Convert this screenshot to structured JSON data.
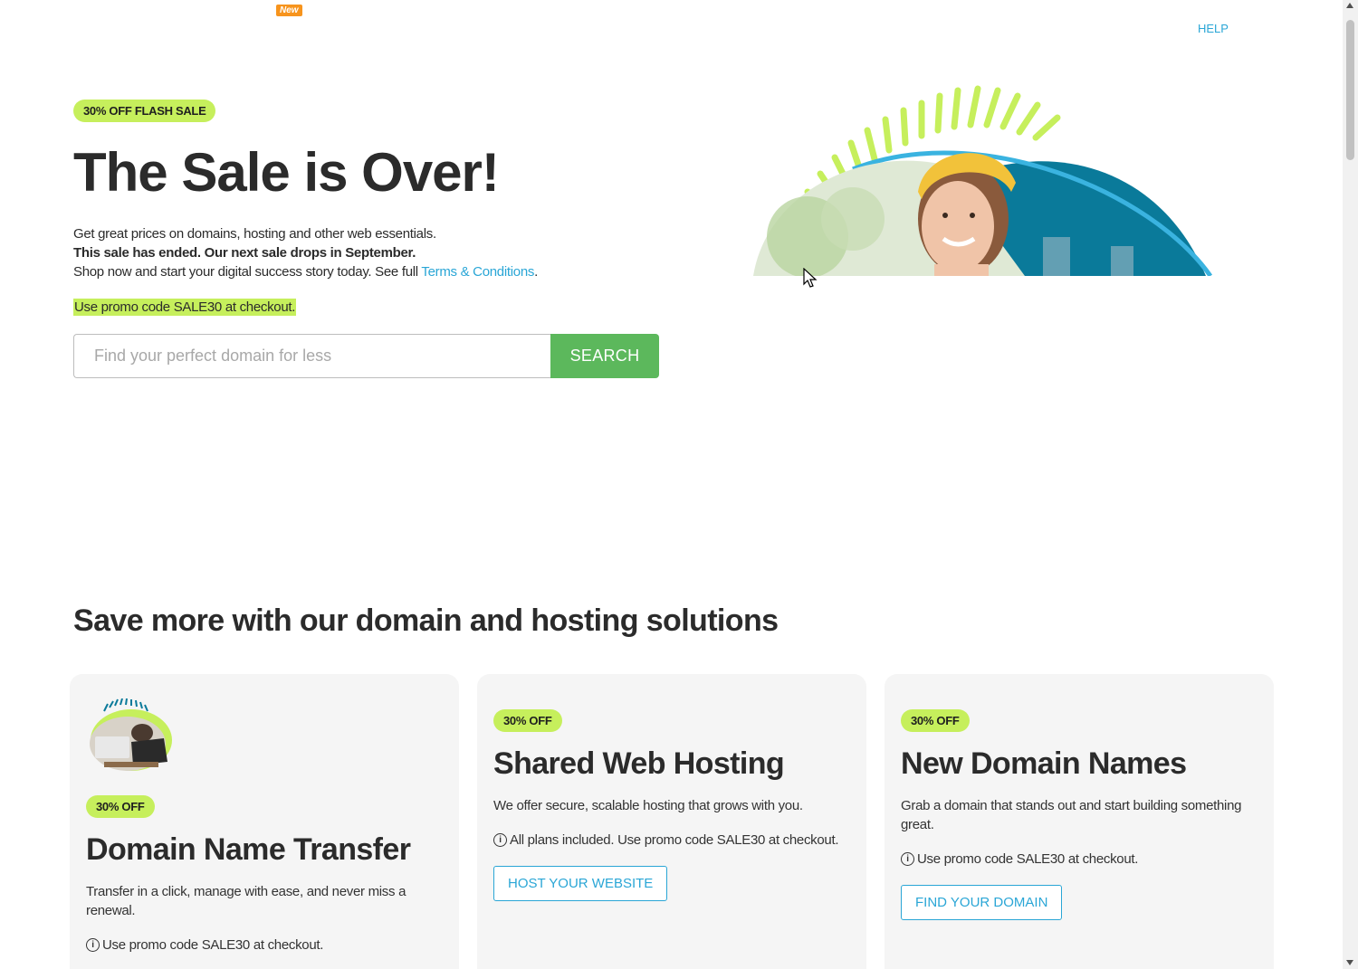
{
  "header": {
    "new_badge": "New",
    "help_link": "HELP"
  },
  "hero": {
    "badge": "30% OFF FLASH SALE",
    "title": "The Sale is Over!",
    "line1": "Get great prices on domains, hosting and other web essentials.",
    "line2": "This sale has ended. Our next sale drops in September.",
    "line3_prefix": "Shop now and start your digital success story today. See full ",
    "terms_link": "Terms & Conditions",
    "line3_suffix": ".",
    "promo": "Use promo code SALE30 at checkout."
  },
  "search": {
    "placeholder": "Find your perfect domain for less",
    "button_label": "SEARCH"
  },
  "section": {
    "title": "Save more with our domain and hosting solutions"
  },
  "cards": [
    {
      "badge": "30% OFF",
      "title": "Domain Name Transfer",
      "desc": "Transfer in a click, manage with ease, and never miss a renewal.",
      "note": "Use promo code SALE30 at checkout."
    },
    {
      "badge": "30% OFF",
      "title": "Shared Web Hosting",
      "desc": "We offer secure, scalable hosting that grows with you.",
      "note": "All plans included. Use promo code SALE30 at checkout.",
      "button": "HOST YOUR WEBSITE"
    },
    {
      "badge": "30% OFF",
      "title": "New Domain Names",
      "desc": "Grab a domain that stands out and start building something great.",
      "note": "Use promo code SALE30 at checkout.",
      "button": "FIND YOUR DOMAIN"
    }
  ],
  "colors": {
    "accent_green": "#c6ef5c",
    "search_button": "#5cb85c",
    "link_blue": "#2aa6d6",
    "badge_orange": "#f7941d",
    "teal": "#0a7a9a"
  }
}
